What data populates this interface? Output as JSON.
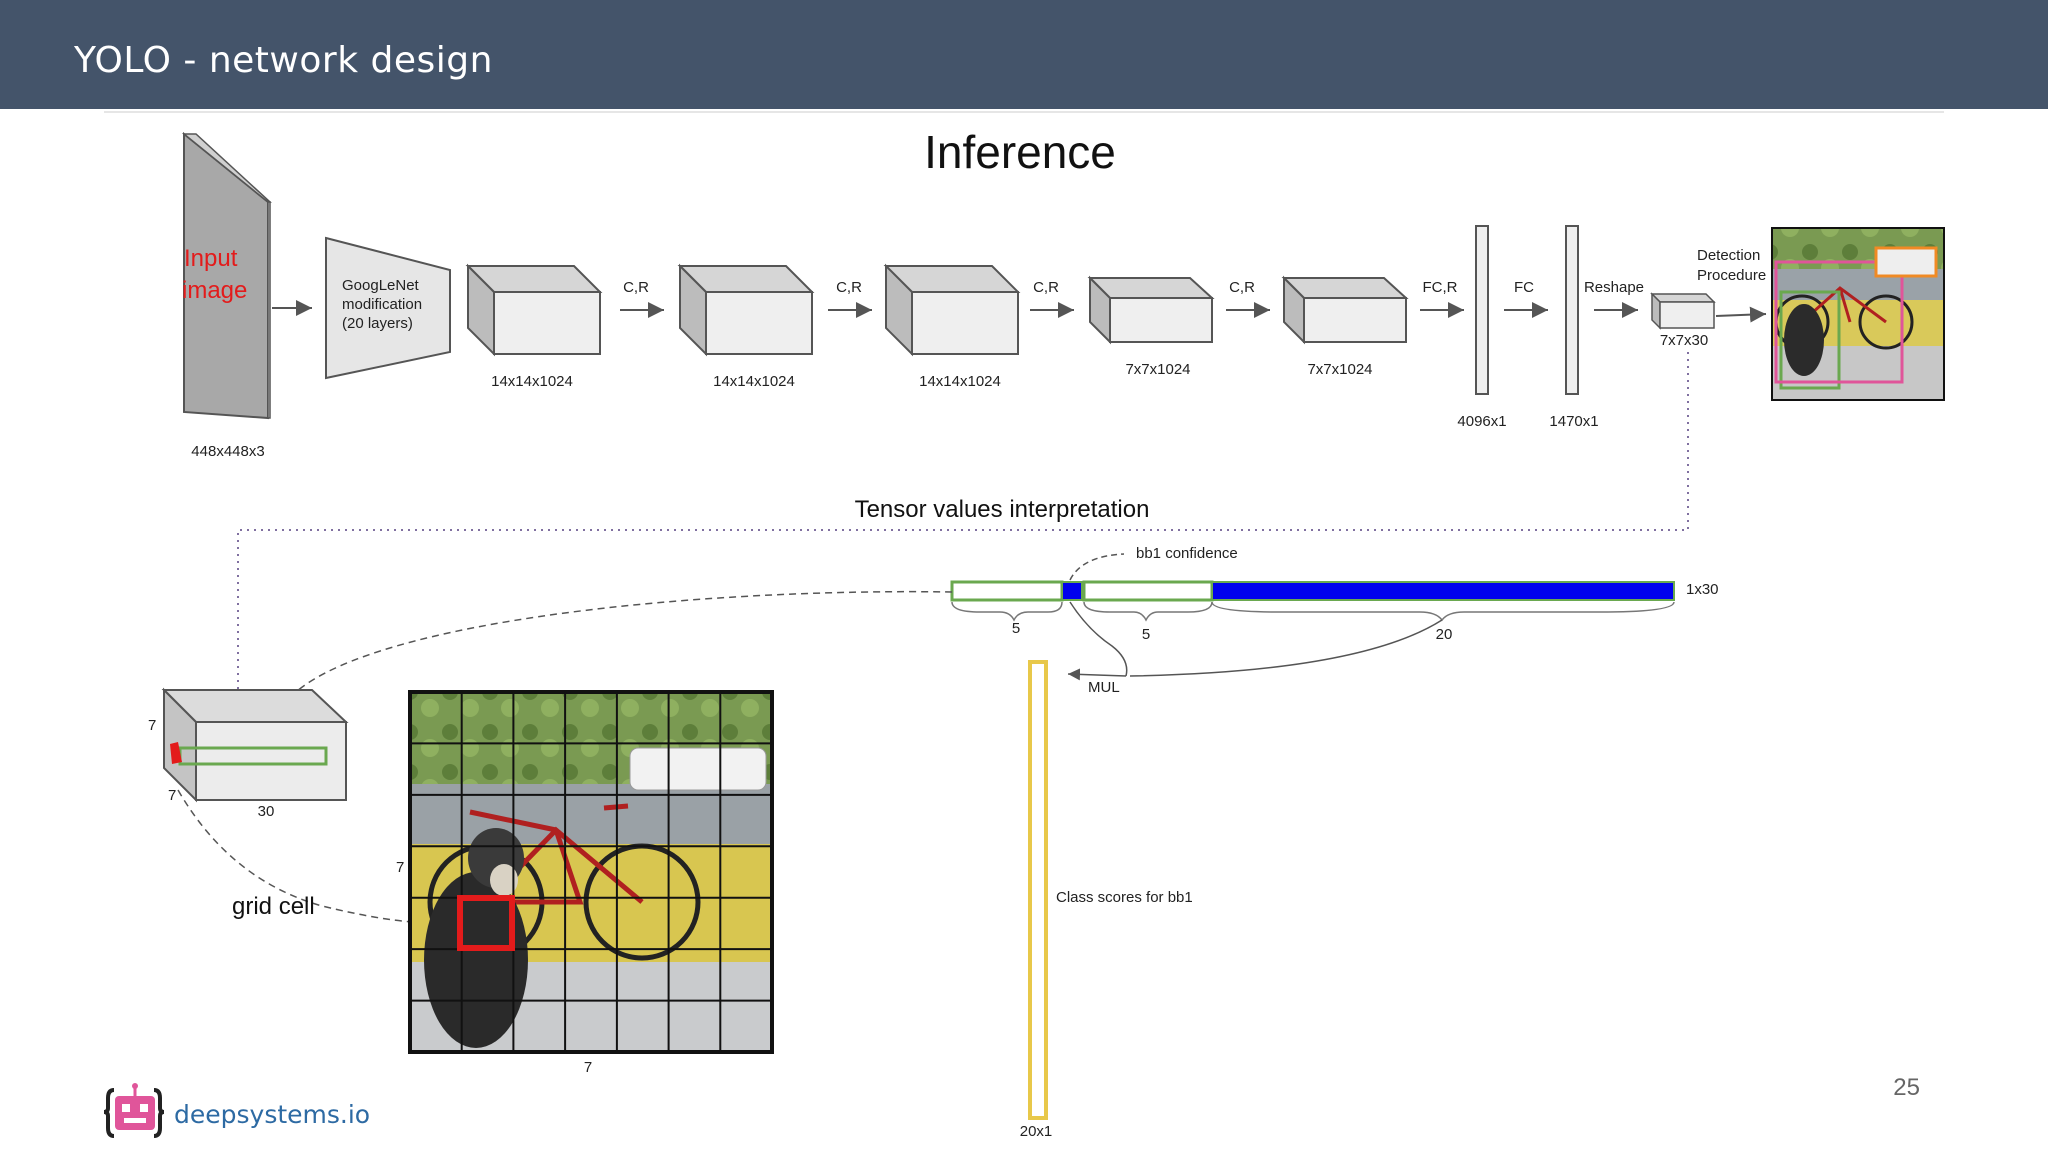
{
  "slide": {
    "title": "YOLO - network design",
    "page_number": "25",
    "logo_text": "deepsystems.io"
  },
  "diagram": {
    "heading": "Inference",
    "input_label_line1": "Input",
    "input_label_line2": "image",
    "input_size": "448x448x3",
    "googlenet_line1": "GoogLeNet",
    "googlenet_line2": "modification",
    "googlenet_line3": "(20 layers)",
    "blocks": [
      "14x14x1024",
      "14x14x1024",
      "14x14x1024",
      "7x7x1024",
      "7x7x1024"
    ],
    "ops": [
      "C,R",
      "C,R",
      "C,R",
      "C,R",
      "FC,R",
      "FC",
      "Reshape"
    ],
    "fc1": "4096x1",
    "fc2": "1470x1",
    "output_tensor": "7x7x30",
    "detection_line1": "Detection",
    "detection_line2": "Procedure",
    "interp_title": "Tensor values interpretation",
    "bb1_confidence": "bb1 confidence",
    "vector_size": "1x30",
    "seg1": "5",
    "seg2": "5",
    "seg3": "20",
    "mul": "MUL",
    "class_scores": "Class scores for bb1",
    "class_vec": "20x1",
    "cube_h": "7",
    "cube_w": "7",
    "cube_d": "30",
    "grid_cell": "grid cell",
    "grid_side_left": "7",
    "grid_side_bottom": "7"
  },
  "colors": {
    "header_bg": "#44546a",
    "green": "#6aa84f",
    "blue": "#0000ee",
    "yellow": "#e8c84a",
    "red": "#e31b1b",
    "pink": "#e0559a",
    "orange": "#f08a24"
  },
  "icons": [
    "robot-logo-icon"
  ]
}
